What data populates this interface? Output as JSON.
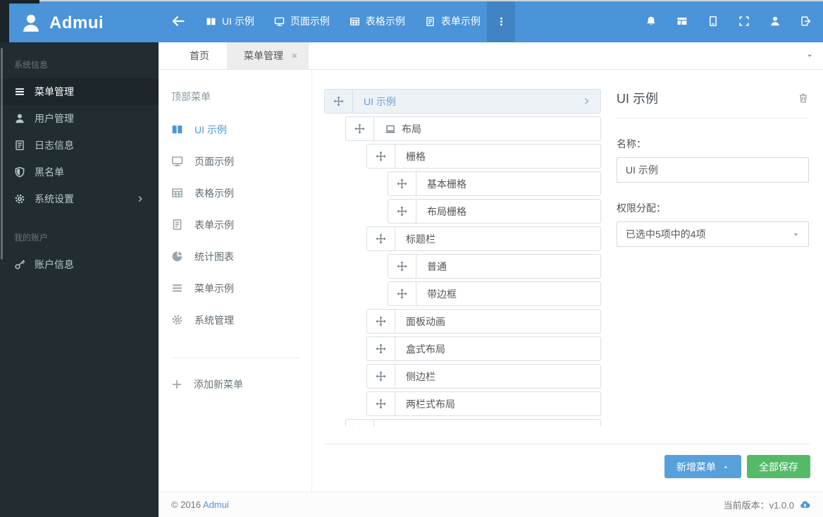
{
  "colors": {
    "primary": "#4b94d9",
    "navbar_bg": "#4b94d9",
    "navbar_more_bg": "#4184c4",
    "sidebar_bg": "#222d32",
    "sidebar_active_bg": "#1c262b",
    "button_blue": "#57a0dc",
    "button_green": "#55ba68",
    "tree_selected_bg": "#edf2f7"
  },
  "navbar": {
    "brand": "Admui",
    "logo_icon": "user-logo-icon",
    "back_icon": "arrow-left-icon",
    "items": [
      {
        "name": "ui-demo",
        "label": "UI 示例",
        "icon": "columns-icon"
      },
      {
        "name": "page-demo",
        "label": "页面示例",
        "icon": "desktop-icon"
      },
      {
        "name": "table-demo",
        "label": "表格示例",
        "icon": "table-icon"
      },
      {
        "name": "form-demo",
        "label": "表单示例",
        "icon": "form-icon"
      }
    ],
    "more_icon": "ellipsis-vertical-icon",
    "right_buttons": [
      {
        "name": "notifications-button",
        "icon": "bell-icon"
      },
      {
        "name": "layout-button",
        "icon": "layout-icon"
      },
      {
        "name": "device-button",
        "icon": "tablet-icon"
      },
      {
        "name": "fullscreen-button",
        "icon": "fullscreen-icon"
      },
      {
        "name": "user-button",
        "icon": "user-icon"
      },
      {
        "name": "logout-button",
        "icon": "signout-icon"
      }
    ]
  },
  "sidebar": {
    "sections": [
      {
        "header": "系统信息",
        "items": [
          {
            "name": "menu-management",
            "label": "菜单管理",
            "icon": "menu-icon",
            "active": true
          },
          {
            "name": "user-management",
            "label": "用户管理",
            "icon": "user-icon"
          },
          {
            "name": "log-info",
            "label": "日志信息",
            "icon": "log-icon"
          },
          {
            "name": "blacklist",
            "label": "黑名单",
            "icon": "shield-icon"
          },
          {
            "name": "system-settings",
            "label": "系统设置",
            "icon": "gear-icon",
            "chevron": true
          }
        ]
      },
      {
        "header": "我的账户",
        "items": [
          {
            "name": "account-info",
            "label": "账户信息",
            "icon": "key-icon"
          }
        ]
      }
    ]
  },
  "tabs": {
    "items": [
      {
        "name": "home",
        "label": "首页"
      },
      {
        "name": "menu-management",
        "label": "菜单管理",
        "active": true,
        "closable": true
      }
    ],
    "caret_icon": "caret-down-icon"
  },
  "menu_panel": {
    "title": "顶部菜单",
    "items": [
      {
        "name": "ui-demo",
        "label": "UI 示例",
        "icon": "columns-icon",
        "active": true
      },
      {
        "name": "page-demo",
        "label": "页面示例",
        "icon": "desktop-icon"
      },
      {
        "name": "table-demo",
        "label": "表格示例",
        "icon": "table-icon"
      },
      {
        "name": "form-demo",
        "label": "表单示例",
        "icon": "form-icon"
      },
      {
        "name": "charts",
        "label": "统计图表",
        "icon": "pie-icon"
      },
      {
        "name": "menu-demo",
        "label": "菜单示例",
        "icon": "menu-icon"
      },
      {
        "name": "system-management",
        "label": "系统管理",
        "icon": "gear-icon"
      }
    ],
    "add_label": "添加新菜单",
    "add_icon": "plus-icon"
  },
  "tree": {
    "drag_icon": "move-icon",
    "rows": [
      {
        "name": "ui-demo",
        "label": "UI 示例",
        "level": 0,
        "selected": true,
        "chevron": true
      },
      {
        "name": "layout",
        "label": "布局",
        "level": 1,
        "icon": "laptop-icon"
      },
      {
        "name": "grid",
        "label": "栅格",
        "level": 2
      },
      {
        "name": "basic-grid",
        "label": "基本栅格",
        "level": 3
      },
      {
        "name": "layout-grid",
        "label": "布局栅格",
        "level": 3
      },
      {
        "name": "title-bar",
        "label": "标题栏",
        "level": 2
      },
      {
        "name": "normal",
        "label": "普通",
        "level": 3
      },
      {
        "name": "with-border",
        "label": "带边框",
        "level": 3
      },
      {
        "name": "panel-animation",
        "label": "面板动画",
        "level": 2
      },
      {
        "name": "box-layout",
        "label": "盒式布局",
        "level": 2
      },
      {
        "name": "sidebar",
        "label": "侧边栏",
        "level": 2
      },
      {
        "name": "two-column-layout",
        "label": "两栏式布局",
        "level": 2
      },
      {
        "name": "clipped-row",
        "label": "",
        "level": 1
      }
    ]
  },
  "detail": {
    "title": "UI 示例",
    "delete_icon": "trash-icon",
    "name_label": "名称：",
    "name_value": "UI 示例",
    "perm_label": "权限分配：",
    "perm_value": "已选中5项中的4项",
    "perm_caret_icon": "caret-down-icon"
  },
  "actions": {
    "add_label": "新增菜单",
    "add_caret_icon": "caret-up-icon",
    "save_label": "全部保存"
  },
  "footer": {
    "copyright": "© 2016",
    "brand": "Admui",
    "version": "当前版本：v1.0.0",
    "update_icon": "cloud-upload-icon"
  }
}
